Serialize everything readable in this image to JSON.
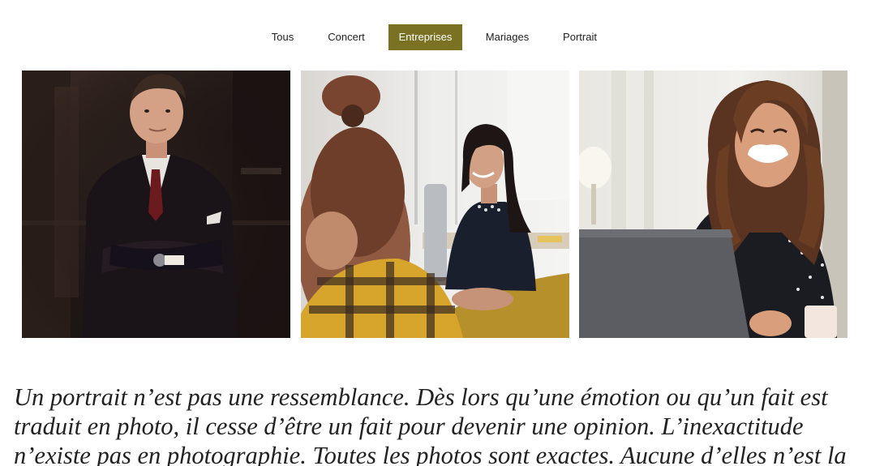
{
  "filters": {
    "items": [
      {
        "label": "Tous"
      },
      {
        "label": "Concert"
      },
      {
        "label": "Entreprises"
      },
      {
        "label": "Mariages"
      },
      {
        "label": "Portrait"
      }
    ],
    "active": "Entreprises",
    "active_color": "#7a7222"
  },
  "gallery": {
    "photos": [
      {
        "subject": "man-in-suit-photo"
      },
      {
        "subject": "office-meeting-photo"
      },
      {
        "subject": "laughing-woman-laptop-photo"
      }
    ]
  },
  "quote": {
    "lines": [
      "Un portrait n’est pas une ressemblance. Dès lors qu’une émotion ou qu’un fait est",
      "traduit en photo, il cesse d’être un fait pour devenir une opinion. L’inexactitude",
      "n’existe pas en photographie. Toutes les photos sont exactes. Aucune d’elles n’est la"
    ]
  }
}
